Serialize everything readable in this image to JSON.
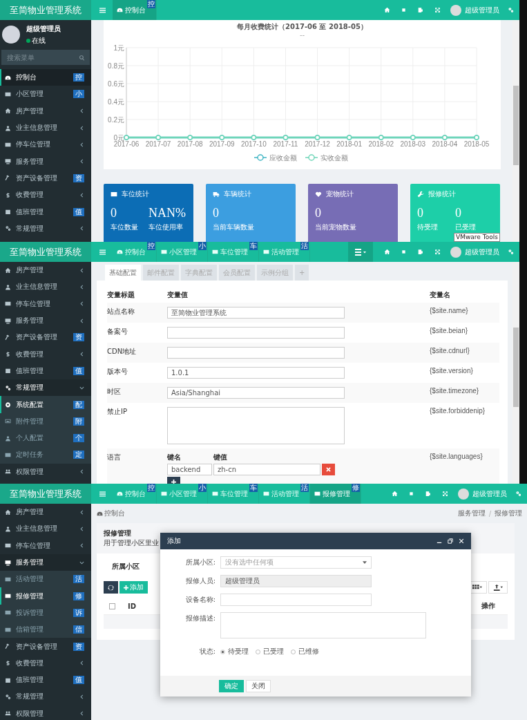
{
  "panels": [
    {
      "kind": "dashboard",
      "brand": "至简物业管理系统",
      "user_name": "超级管理员",
      "tabs": [
        {
          "label": "控制台",
          "badge": "控",
          "kind": "dashboard",
          "selected": true
        }
      ],
      "profile": {
        "name": "超级管理员",
        "status": "在线"
      },
      "search": {
        "placeholder": "搜索菜单"
      },
      "menu": [
        {
          "label": "控制台",
          "kind": "dashboard",
          "badge": "控",
          "selected": true
        },
        {
          "label": "小区管理",
          "kind": "table",
          "badge": "小",
          "selected": false
        },
        {
          "label": "房产管理",
          "kind": "home",
          "expanded": false,
          "selected": false
        },
        {
          "label": "业主信息管理",
          "kind": "user",
          "expanded": false,
          "selected": false
        },
        {
          "label": "停车位管理",
          "kind": "film",
          "expanded": false,
          "selected": false
        },
        {
          "label": "服务管理",
          "kind": "desktop",
          "expanded": false,
          "selected": false
        },
        {
          "label": "资产设备管理",
          "kind": "hammer",
          "badge": "资",
          "selected": false
        },
        {
          "label": "收费管理",
          "kind": "dollar",
          "expanded": false,
          "selected": false
        },
        {
          "label": "值班管理",
          "kind": "calendar",
          "badge": "值",
          "selected": false
        },
        {
          "label": "常规管理",
          "kind": "cogs",
          "expanded": false,
          "selected": false
        }
      ],
      "chart_card": {
        "subtitle": "--",
        "chart_data": {
          "type": "line",
          "title": "每月收费统计（2017-06 至 2018-05）",
          "categories": [
            "2017-06",
            "2017-07",
            "2017-08",
            "2017-09",
            "2017-10",
            "2017-11",
            "2017-12",
            "2018-01",
            "2018-02",
            "2018-03",
            "2018-04",
            "2018-05"
          ],
          "series": [
            {
              "name": "应收金额",
              "color": "#41b6c4",
              "marker": "circle",
              "values": [
                0,
                0,
                0,
                0,
                0,
                0,
                0,
                0,
                0,
                0,
                0,
                0
              ]
            },
            {
              "name": "实收金额",
              "color": "#6fd6b8",
              "marker": "circle",
              "values": [
                0,
                0,
                0,
                0,
                0,
                0,
                0,
                0,
                0,
                0,
                0,
                0
              ]
            }
          ],
          "ylim": [
            0,
            1
          ],
          "grid": true,
          "legend": true,
          "yticks": [
            {
              "value": 0,
              "label": "0元"
            },
            {
              "value": 0.2,
              "label": "0.2元"
            },
            {
              "value": 0.4,
              "label": "0.4元"
            },
            {
              "value": 0.6,
              "label": "0.6元"
            },
            {
              "value": 0.8,
              "label": "0.8元"
            },
            {
              "value": 1,
              "label": "1元"
            }
          ]
        }
      },
      "stats": [
        {
          "title": "车位统计",
          "kind": "film",
          "color": "#0c6db5",
          "items": [
            {
              "value": "0",
              "label": "车位数量"
            },
            {
              "value": "NAN%",
              "label": "车位使用率"
            }
          ]
        },
        {
          "title": "车辆统计",
          "kind": "truck",
          "color": "#3c9ee0",
          "items": [
            {
              "value": "0",
              "label": "当前车辆数量"
            }
          ]
        },
        {
          "title": "宠物统计",
          "kind": "heart",
          "color": "#776db5",
          "items": [
            {
              "value": "0",
              "label": "当前宠物数量"
            }
          ]
        },
        {
          "title": "报修统计",
          "kind": "wrench",
          "color": "#1dcfa8",
          "items": [
            {
              "value": "0",
              "label": "待受理"
            },
            {
              "value": "0",
              "label": "已受理"
            }
          ]
        }
      ],
      "tooltip": "VMware Tools"
    },
    {
      "kind": "config",
      "brand": "至简物业管理系统",
      "tab_menu": true,
      "user_name": "超级管理员",
      "tabs": [
        {
          "label": "控制台",
          "badge": "控",
          "kind": "dashboard",
          "selected": false
        },
        {
          "label": "小区管理",
          "badge": "小",
          "kind": "table",
          "selected": false
        },
        {
          "label": "车位管理",
          "badge": "车",
          "kind": "table",
          "selected": false
        },
        {
          "label": "活动管理",
          "badge": "活",
          "kind": "table",
          "selected": false
        }
      ],
      "menu": [
        {
          "label": "房产管理",
          "kind": "home",
          "expanded": false,
          "selected": false
        },
        {
          "label": "业主信息管理",
          "kind": "user",
          "expanded": false,
          "selected": false
        },
        {
          "label": "停车位管理",
          "kind": "film",
          "expanded": false,
          "selected": false
        },
        {
          "label": "服务管理",
          "kind": "desktop",
          "expanded": false,
          "selected": false
        },
        {
          "label": "资产设备管理",
          "kind": "hammer",
          "badge": "资",
          "selected": false
        },
        {
          "label": "收费管理",
          "kind": "dollar",
          "expanded": false,
          "selected": false
        },
        {
          "label": "值班管理",
          "kind": "calendar",
          "badge": "值",
          "selected": false
        },
        {
          "label": "常规管理",
          "kind": "cogs",
          "expanded": true,
          "selected": false,
          "children": [
            {
              "label": "系统配置",
              "kind": "gear",
              "badge": "配",
              "selected": true
            },
            {
              "label": "附件管理",
              "kind": "image",
              "badge": "附",
              "selected": false
            },
            {
              "label": "个人配置",
              "kind": "user",
              "badge": "个",
              "selected": false
            },
            {
              "label": "定时任务",
              "kind": "table",
              "badge": "定",
              "selected": false
            }
          ]
        },
        {
          "label": "权限管理",
          "kind": "users",
          "expanded": false,
          "selected": false
        }
      ],
      "config_tabs": [
        {
          "label": "基础配置",
          "selected": true
        },
        {
          "label": "邮件配置",
          "selected": false
        },
        {
          "label": "字典配置",
          "selected": false
        },
        {
          "label": "会员配置",
          "selected": false
        },
        {
          "label": "示例分组",
          "selected": false
        },
        {
          "label": "+",
          "selected": false
        }
      ],
      "columns": [
        "变量标题",
        "变量值",
        "变量名"
      ],
      "rows": [
        {
          "kind": "input",
          "title": "站点名称",
          "value": "至简物业管理系统",
          "variable": "{$site.name}"
        },
        {
          "kind": "input",
          "title": "备案号",
          "variable": "{$site.beian}"
        },
        {
          "kind": "input",
          "title": "CDN地址",
          "variable": "{$site.cdnurl}"
        },
        {
          "kind": "input",
          "title": "版本号",
          "value": "1.0.1",
          "variable": "{$site.version}"
        },
        {
          "kind": "input",
          "title": "时区",
          "value": "Asia/Shanghai",
          "variable": "{$site.timezone}"
        },
        {
          "kind": "textarea",
          "title": "禁止IP",
          "variable": "{$site.forbiddenip}"
        },
        {
          "kind": "keyvalue",
          "title": "语言",
          "key_label": "键名",
          "value_label": "键值",
          "pairs": [
            {
              "key": "backend",
              "value": "zh-cn"
            }
          ],
          "variable": "{$site.languages}"
        }
      ]
    },
    {
      "kind": "list",
      "brand": "至简物业管理系统",
      "user_name": "超级管理员",
      "tabs": [
        {
          "label": "控制台",
          "badge": "控",
          "kind": "dashboard",
          "selected": false
        },
        {
          "label": "小区管理",
          "badge": "小",
          "kind": "table",
          "selected": false
        },
        {
          "label": "车位管理",
          "badge": "车",
          "kind": "table",
          "selected": false
        },
        {
          "label": "活动管理",
          "badge": "活",
          "kind": "table",
          "selected": false
        },
        {
          "label": "报修管理",
          "badge": "修",
          "kind": "table",
          "selected": true
        }
      ],
      "menu": [
        {
          "label": "房产管理",
          "kind": "home",
          "expanded": false,
          "selected": false
        },
        {
          "label": "业主信息管理",
          "kind": "user",
          "expanded": false,
          "selected": false
        },
        {
          "label": "停车位管理",
          "kind": "film",
          "expanded": false,
          "selected": false
        },
        {
          "label": "服务管理",
          "kind": "desktop",
          "expanded": true,
          "selected": false,
          "children": [
            {
              "label": "活动管理",
              "kind": "table",
              "badge": "活",
              "selected": false
            },
            {
              "label": "报修管理",
              "kind": "table",
              "badge": "修",
              "selected": true
            },
            {
              "label": "投诉管理",
              "kind": "table",
              "badge": "诉",
              "selected": false
            },
            {
              "label": "信箱管理",
              "kind": "table",
              "badge": "信",
              "selected": false
            }
          ]
        },
        {
          "label": "资产设备管理",
          "kind": "hammer",
          "badge": "资",
          "selected": false
        },
        {
          "label": "收费管理",
          "kind": "dollar",
          "expanded": false,
          "selected": false
        },
        {
          "label": "值班管理",
          "kind": "calendar",
          "badge": "值",
          "selected": false
        },
        {
          "label": "常规管理",
          "kind": "cogs",
          "expanded": false,
          "selected": false
        },
        {
          "label": "权限管理",
          "kind": "users",
          "expanded": false,
          "selected": false
        }
      ],
      "breadcrumb_home": "控制台",
      "breadcrumb": [
        "服务管理",
        "报修管理"
      ],
      "page_title": "报修管理",
      "page_desc": "用于管理小区里业",
      "filter_label": "所属小区",
      "add_button": "添加",
      "select_all": {
        "checked": false
      },
      "table_columns": [
        "ID",
        "操作"
      ],
      "dialog": {
        "title": "添加",
        "fields": [
          {
            "kind": "select",
            "label": "所属小区:",
            "placeholder": "没有选中任何项"
          },
          {
            "kind": "readonly",
            "label": "报修人员:",
            "value": "超级管理员"
          },
          {
            "kind": "input",
            "label": "设备名称:"
          },
          {
            "kind": "textarea",
            "label": "报修描述:"
          },
          {
            "kind": "radio",
            "label": "状态:",
            "options": [
              {
                "label": "待受理",
                "selected": true
              },
              {
                "label": "已受理",
                "selected": false
              },
              {
                "label": "已维修",
                "selected": false
              }
            ]
          }
        ],
        "buttons": [
          {
            "label": "确定",
            "kind": "primary"
          },
          {
            "label": "关闭",
            "kind": "default"
          }
        ]
      }
    }
  ]
}
